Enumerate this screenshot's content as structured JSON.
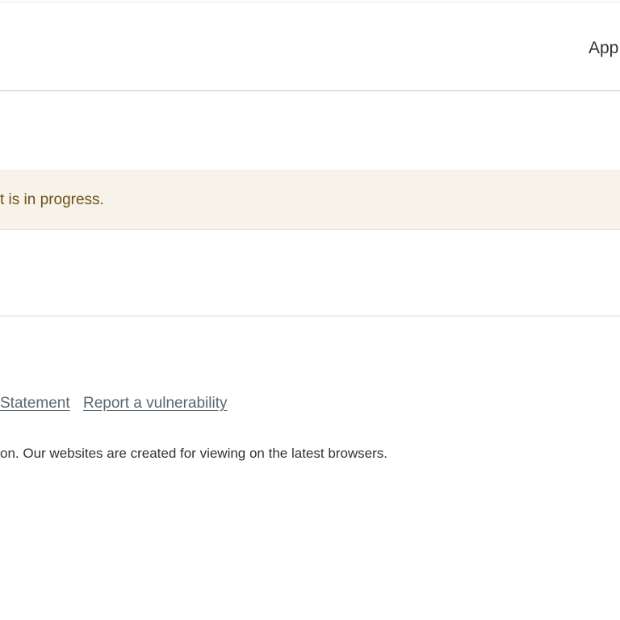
{
  "header": {
    "nav_link": "App"
  },
  "notice": {
    "text": "t is in progress."
  },
  "footer": {
    "links": [
      {
        "label": "Statement"
      },
      {
        "label": "Report a vulnerability"
      }
    ],
    "note": "on. Our websites are created for viewing on the latest browsers."
  },
  "colors": {
    "notice_background": "#f8f3ea",
    "notice_text": "#6b5216",
    "link": "#596873"
  }
}
